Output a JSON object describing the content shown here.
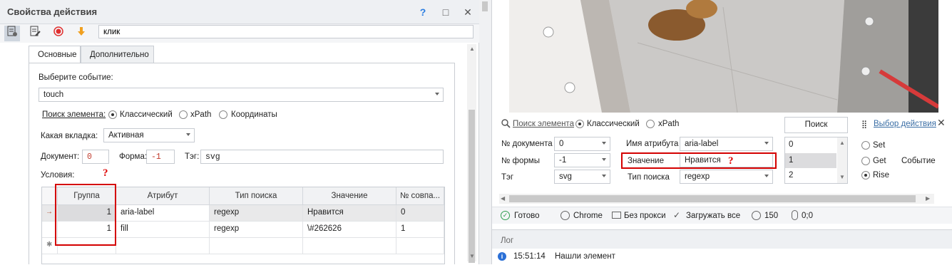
{
  "window": {
    "title": "Свойства действия",
    "help": "?",
    "maximize": "□",
    "close": "✕"
  },
  "toolbar": {
    "name_value": "клик"
  },
  "tabs": [
    "Основные",
    "Дополнительно"
  ],
  "event": {
    "label": "Выберите событие:",
    "value": "touch"
  },
  "search": {
    "label": "Поиск элемента:",
    "options": [
      "Классический",
      "xPath",
      "Координаты"
    ],
    "selected": "Классический"
  },
  "tab_select": {
    "label": "Какая вкладка:",
    "value": "Активная"
  },
  "doc": {
    "label": "Документ:",
    "value": "0",
    "form_label": "Форма:",
    "form_value": "-1",
    "tag_label": "Тэг:",
    "tag_value": "svg"
  },
  "conditions": {
    "label": "Условия:",
    "marker": "?"
  },
  "grid": {
    "headers": [
      "Группа",
      "Атрибут",
      "Тип поиска",
      "Значение",
      "№ совпа..."
    ],
    "rows": [
      {
        "group": "1",
        "attr": "aria-label",
        "type": "regexp",
        "value": "Нравится",
        "match": "0"
      },
      {
        "group": "1",
        "attr": "fill",
        "type": "regexp",
        "value": "\\#262626",
        "match": "1"
      }
    ],
    "row_marker": "→",
    "new_marker": "✱"
  },
  "right": {
    "search_link": "Поиск элемента",
    "search_modes": [
      "Классический",
      "xPath"
    ],
    "search_button": "Поиск",
    "action_link": "Выбор действия",
    "close": "✕",
    "doc_label": "№ документа",
    "doc_value": "0",
    "form_label": "№ формы",
    "form_value": "-1",
    "tag_label": "Тэг",
    "tag_value": "svg",
    "attr_name_label": "Имя атрибута",
    "attr_name_value": "aria-label",
    "value_label": "Значение",
    "value_value": "Нравится",
    "value_marker": "?",
    "search_type_label": "Тип поиска",
    "search_type_value": "regexp",
    "list": [
      "0",
      "1",
      "2"
    ],
    "event_options": [
      "Set",
      "Get",
      "Rise"
    ],
    "event_selected": "Rise",
    "event_label": "Событие"
  },
  "status": {
    "ready": "Готово",
    "browser": "Chrome",
    "proxy": "Без прокси",
    "load": "Загружать все",
    "count": "150",
    "coords": "0;0"
  },
  "log": {
    "title": "Лог",
    "time": "15:51:14",
    "message": "Нашли элемент"
  },
  "colors": {
    "accent_red": "#d40000",
    "link": "#3a6ea5",
    "status_green": "#2e9e4f"
  }
}
